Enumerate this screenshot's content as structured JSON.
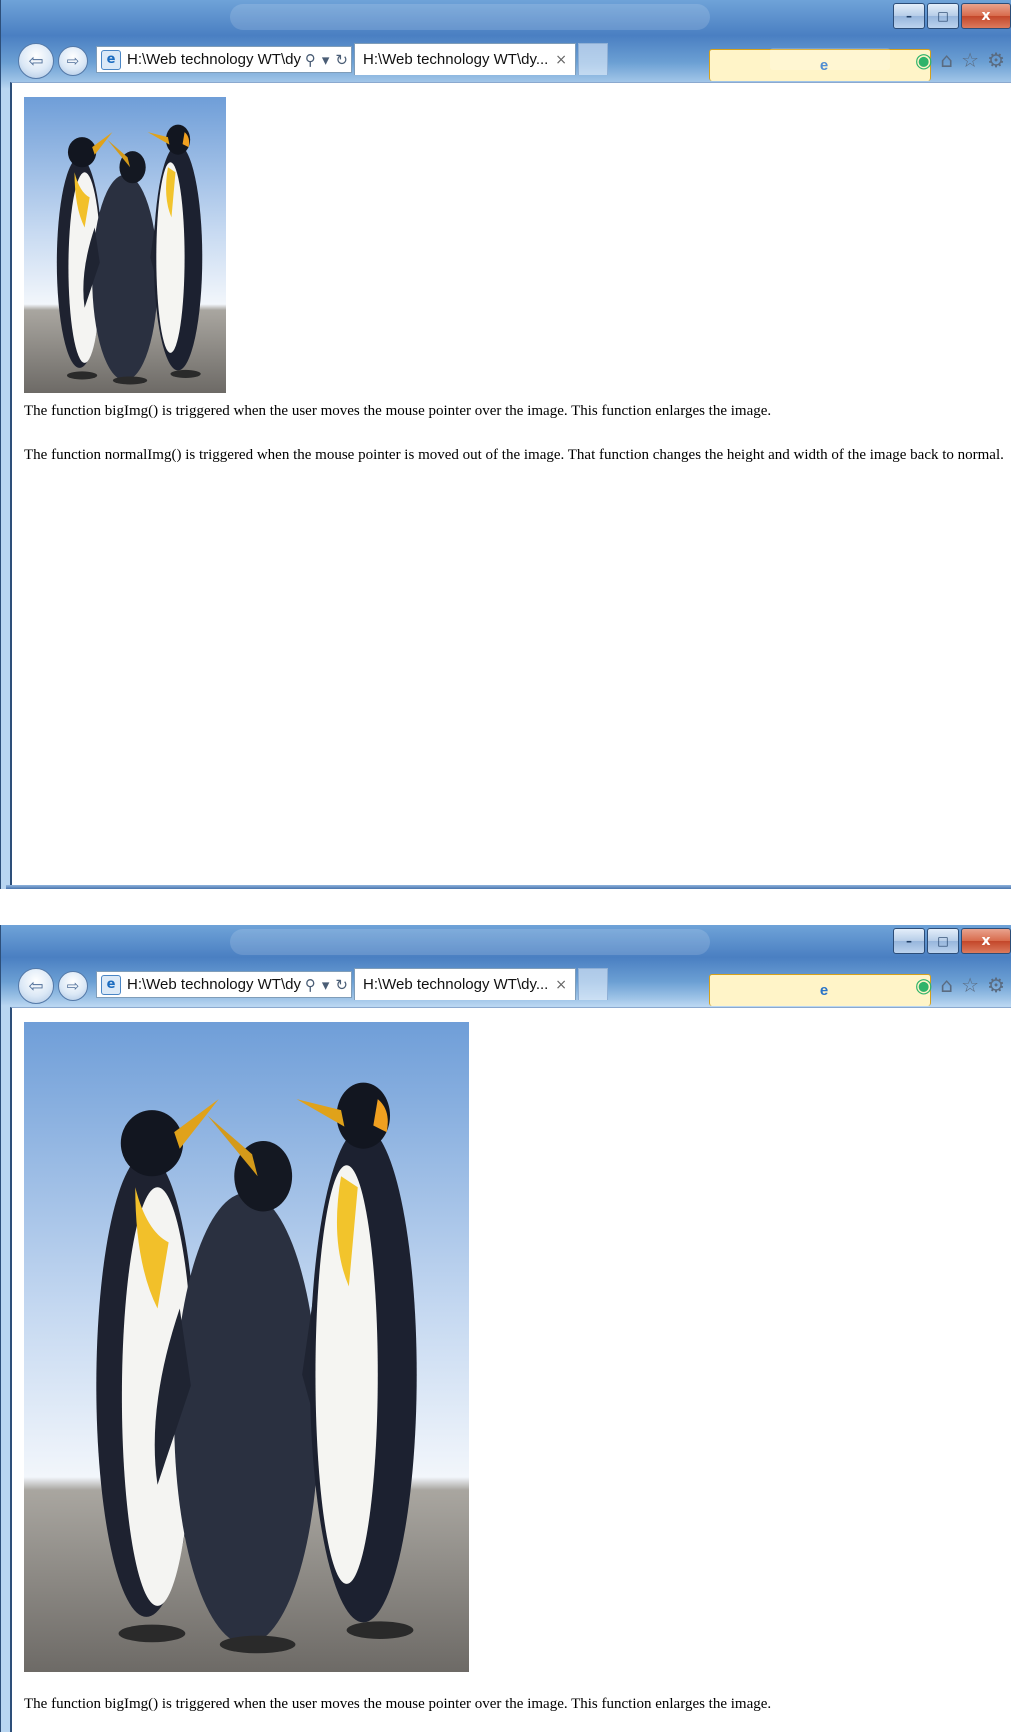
{
  "browser": {
    "address_text": "H:\\Web technology WT\\dyr",
    "tab_title": "H:\\Web technology WT\\dy...",
    "tab_close": "×",
    "caption_buttons": {
      "minimize": "–",
      "maximize": "□",
      "close": "x"
    },
    "icons": [
      "back-arrow-icon",
      "forward-arrow-icon",
      "ie-page-icon",
      "search-icon",
      "dropdown-icon",
      "refresh-icon",
      "home-icon",
      "favorites-star-icon",
      "settings-gear-icon"
    ]
  },
  "page": {
    "paragraph_1": "The function bigImg() is triggered when the user moves the mouse pointer over the image. This function enlarges the image.",
    "paragraph_2": "The function normalImg() is triggered when the mouse pointer is moved out of the image. That function changes the height and width of the image back to normal."
  },
  "colors": {
    "title_bar": "#4a7fc2",
    "close_button": "#c3472a",
    "accent_green": "#2fb36a"
  }
}
